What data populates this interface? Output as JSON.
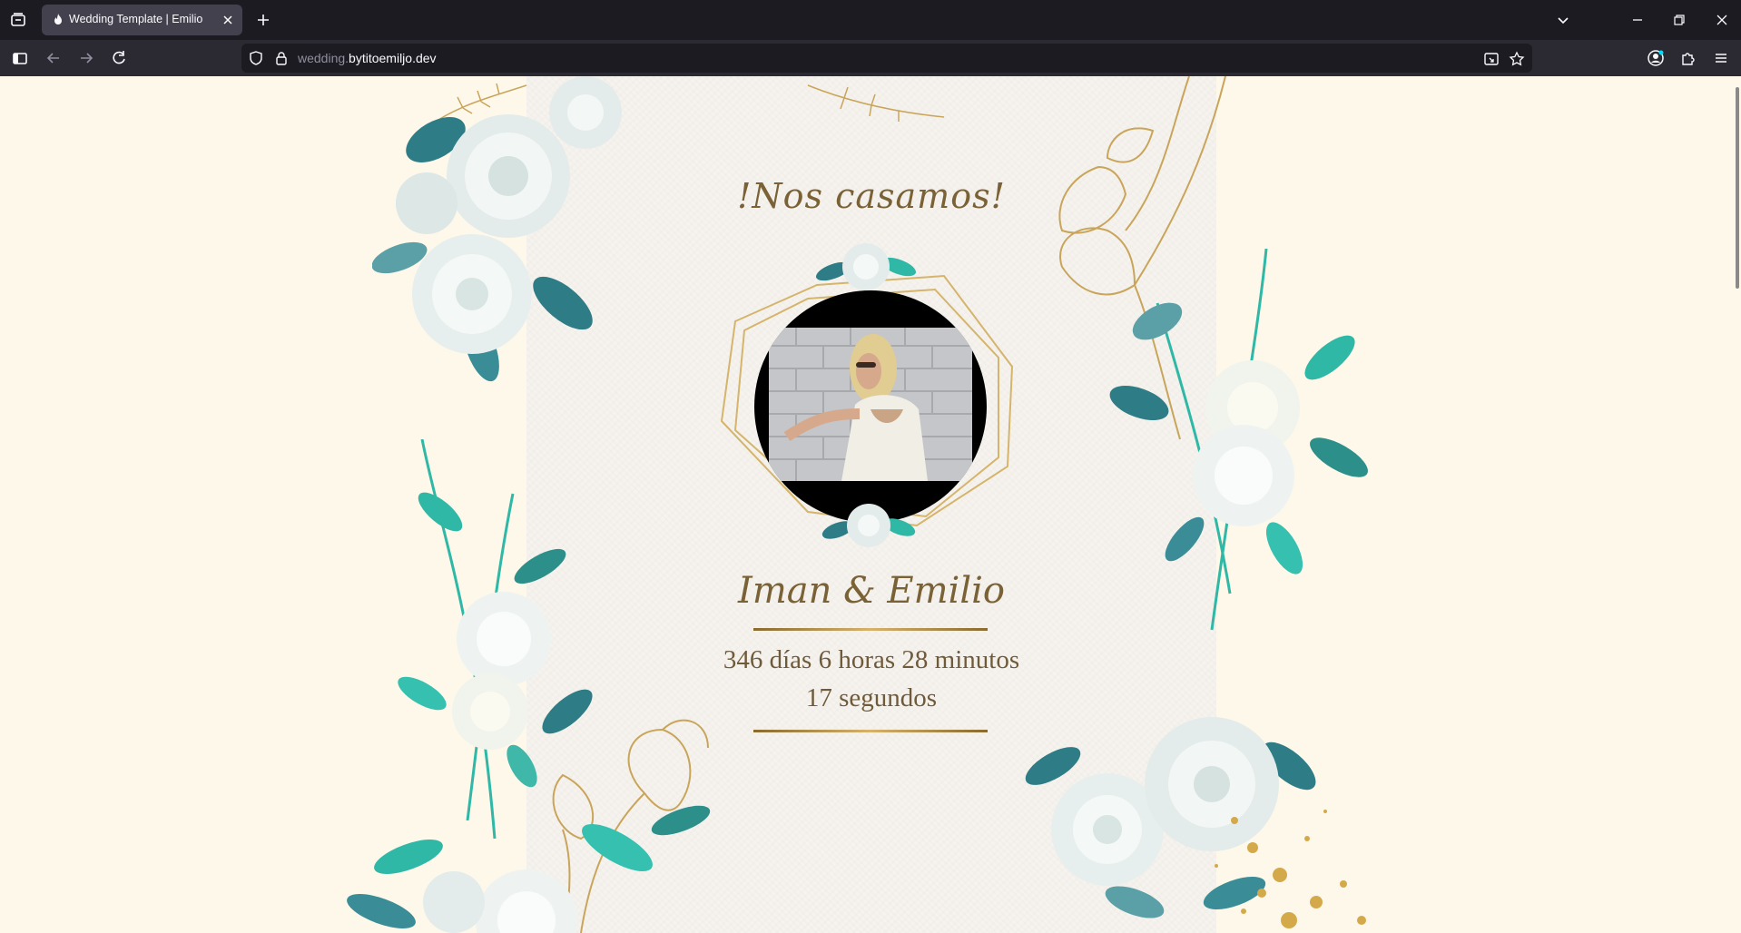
{
  "browser": {
    "tab_title": "Wedding Template | Emilio",
    "url_prefix": "wedding.",
    "url_host": "bytitoemiljo.dev"
  },
  "page": {
    "heading": "!Nos casamos!",
    "names": "Iman & Emilio",
    "countdown": {
      "line1": "346 días 6 horas 28 minutos",
      "line2": "17 segundos"
    }
  },
  "colors": {
    "background": "#fdf8ea",
    "paper": "#f6f3ee",
    "gold": "#c9a55b",
    "text_brown": "#7a6236",
    "teal": "#2fb8a6"
  },
  "icons": {
    "tab_list": "tab-list-icon",
    "favicon": "flame-icon",
    "close": "close-icon",
    "new_tab": "plus-icon",
    "sidebar": "sidebar-icon",
    "back": "arrow-left-icon",
    "forward": "arrow-right-icon",
    "reload": "reload-icon",
    "shield": "shield-icon",
    "lock": "lock-icon",
    "permissions": "picture-in-picture-icon",
    "bookmark": "star-icon",
    "account": "account-icon",
    "extensions": "puzzle-icon",
    "menu": "hamburger-icon"
  }
}
